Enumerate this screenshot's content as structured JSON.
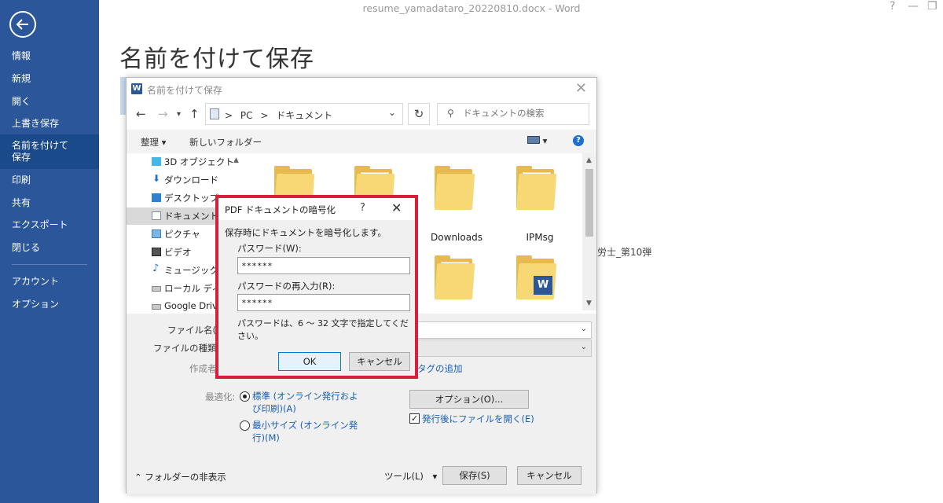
{
  "window": {
    "doc_title": "resume_yamadataro_20220810.docx - Word",
    "help": "?",
    "minimize": "—",
    "restore": "❐"
  },
  "rail": {
    "items": [
      "情報",
      "新規",
      "開く",
      "上書き保存",
      "名前を付けて保存",
      "印刷",
      "共有",
      "エクスポート",
      "閉じる",
      "アカウント",
      "オプション"
    ],
    "selected_line1": "名前を付けて",
    "selected_line2": "保存"
  },
  "page": {
    "title": "名前を付けて保存",
    "bg_right_text": "士労士_第10弾"
  },
  "save_dialog": {
    "title": "名前を付けて保存",
    "address": {
      "path_root": "PC",
      "path_leaf": "ドキュメント",
      "separator": ">"
    },
    "search_placeholder": "ドキュメントの検索",
    "toolbar": {
      "organize": "整理 ▾",
      "new_folder": "新しいフォルダー"
    },
    "nav_items": [
      "3D オブジェクト",
      "ダウンロード",
      "デスクトップ",
      "ドキュメント",
      "ピクチャ",
      "ビデオ",
      "ミュージック",
      "ローカル ディスク",
      "Google Drive"
    ],
    "folders": [
      "Downloads",
      "IPMsg"
    ],
    "form": {
      "filename_label": "ファイル名(N):",
      "filetype_label": "ファイルの種類(T):",
      "author_label": "作成者:",
      "tag_link": "タグの追加",
      "optimize_label": "最適化:",
      "radio_standard": "標準 (オンライン発行および印刷)(A)",
      "radio_standard_l1": "標準 (オンライン発行およ",
      "radio_standard_l2": "び印刷)(A)",
      "radio_min_l1": "最小サイズ (オンライン発",
      "radio_min_l2": "行)(M)",
      "options_button": "オプション(O)...",
      "open_after_label": "発行後にファイルを開く(E)",
      "open_after_checked": true
    },
    "footer": {
      "hide_folders": "フォルダーの非表示",
      "tools": "ツール(L)",
      "save": "保存(S)",
      "cancel": "キャンセル"
    }
  },
  "pw_dialog": {
    "title": "PDF ドキュメントの暗号化",
    "help": "?",
    "close": "✕",
    "intro": "保存時にドキュメントを暗号化します。",
    "password_label": "パスワード(W):",
    "password_value": "******",
    "reenter_label": "パスワードの再入力(R):",
    "reenter_value": "******",
    "hint": "パスワードは、6 ～ 32 文字で指定してください。",
    "ok": "OK",
    "cancel": "キャンセル"
  },
  "colors": {
    "rail_bg": "#2b579a",
    "highlight_frame": "#d6203b",
    "link": "#1a5fb4"
  }
}
